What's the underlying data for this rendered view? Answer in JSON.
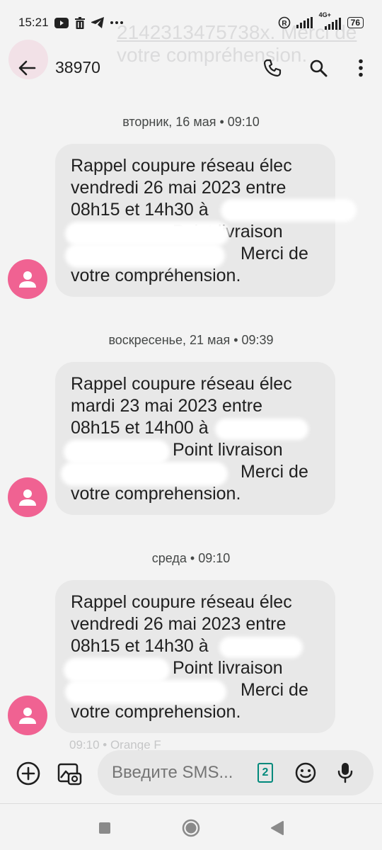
{
  "status_bar": {
    "time": "15:21",
    "battery": "76",
    "network": "4G+",
    "icons": [
      "youtube-icon",
      "trash-icon",
      "telegram-icon",
      "more-notifications-icon",
      "registered-icon",
      "signal-icon",
      "signal-4g-icon",
      "battery-icon"
    ]
  },
  "background": {
    "faded_line_1": "2142313475738х. Merci de",
    "faded_line_2": "votre compréhension."
  },
  "app_bar": {
    "title": "38970",
    "icons": [
      "back-arrow-icon",
      "phone-icon",
      "search-icon",
      "more-vert-icon"
    ]
  },
  "conversation": [
    {
      "date_header": "вторник, 16 мая • 09:10",
      "lines": [
        "Rappel coupure réseau élec",
        "vendredi 26 mai 2023 entre",
        "08h15 et 14h30 à",
        "Point livraison",
        "Merci de",
        "votre compréhension."
      ]
    },
    {
      "date_header": "воскресенье, 21 мая • 09:39",
      "lines": [
        "Rappel coupure réseau élec",
        "mardi 23 mai 2023 entre",
        "08h15 et 14h00 à",
        "Point livraison",
        "Merci de",
        "votre comprehension."
      ]
    },
    {
      "date_header": "среда • 09:10",
      "lines": [
        "Rappel coupure réseau élec",
        "vendredi 26 mai 2023 entre",
        "08h15 et 14h30 à",
        "Point livraison",
        "Merci de",
        "votre comprehension."
      ]
    }
  ],
  "peek_text": "09:10 • Orange F",
  "compose": {
    "placeholder": "Введите SMS...",
    "sim_slot": "2",
    "icons": [
      "add-circle-icon",
      "gallery-icon",
      "emoji-icon",
      "mic-icon"
    ]
  },
  "nav_bar": {
    "icons": [
      "recents-square-icon",
      "home-circle-icon",
      "back-triangle-icon"
    ]
  },
  "colors": {
    "avatar": "#f06292",
    "bubble": "#e8e8e8",
    "background": "#f3f3f3",
    "sim_badge": "#00897b"
  }
}
